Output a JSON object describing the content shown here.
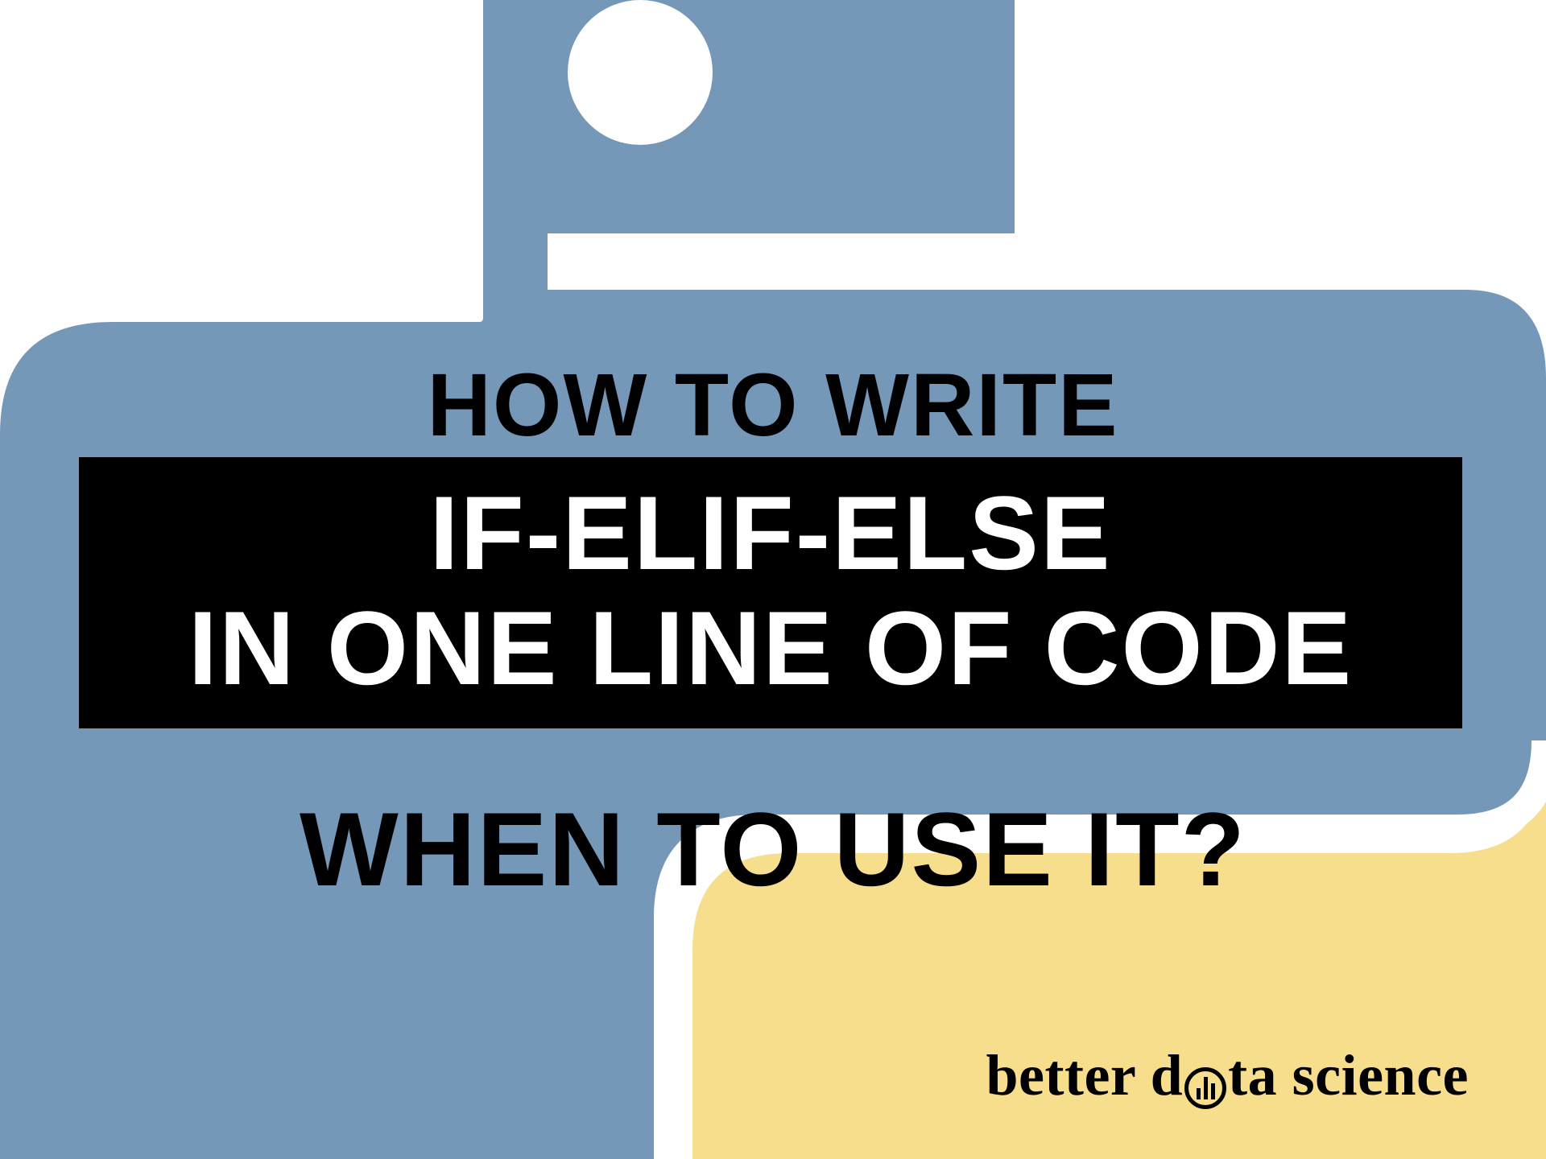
{
  "headline": {
    "line1": "HOW TO WRITE",
    "highlight_line1": "IF-ELIF-ELSE",
    "highlight_line2": "IN ONE LINE OF CODE",
    "line4": "WHEN TO USE IT?"
  },
  "brand": {
    "prefix": "better d",
    "suffix": "ta science",
    "icon_name": "bar-chart-icon"
  },
  "colors": {
    "blue": "#7597b8",
    "yellow": "#f6de8d",
    "black": "#000000",
    "white": "#ffffff"
  }
}
